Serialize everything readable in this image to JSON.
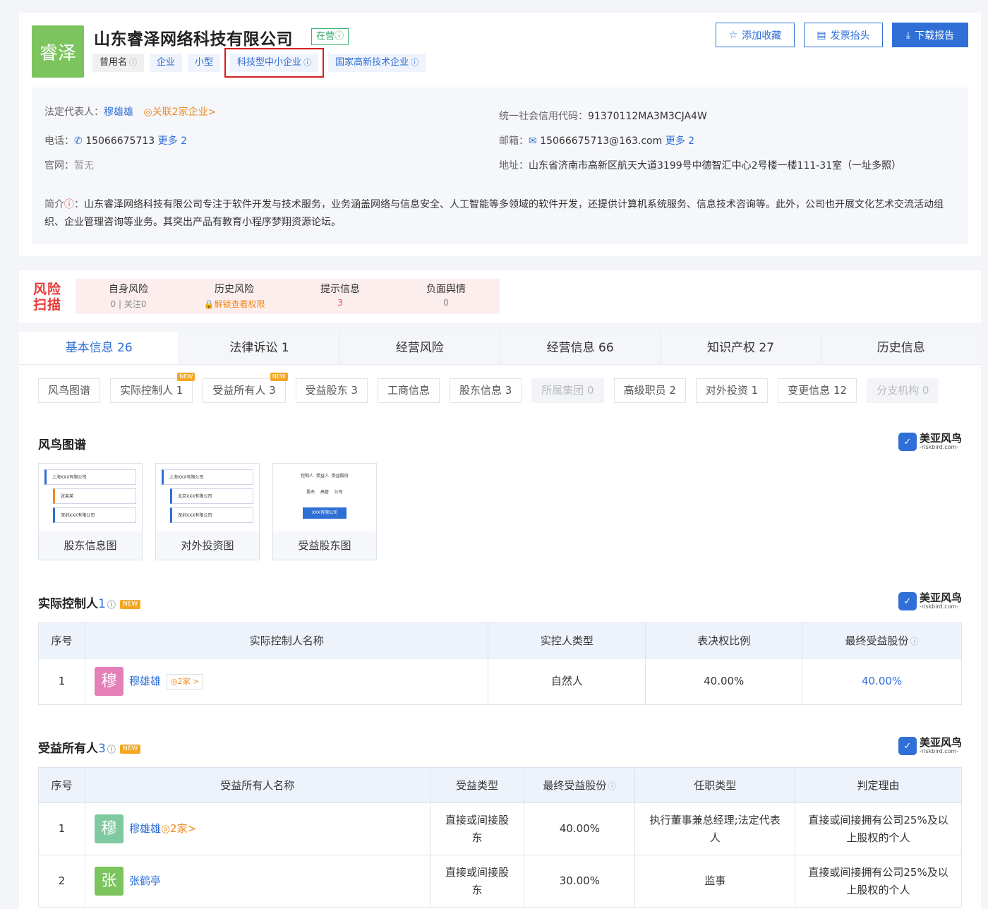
{
  "company": {
    "logo_text": "睿泽",
    "name": "山东睿泽网络科技有限公司",
    "status": "在营ⓘ",
    "tags": [
      {
        "label": "曾用名",
        "info": "ⓘ"
      },
      {
        "label": "企业",
        "info": ""
      },
      {
        "label": "小型",
        "info": ""
      },
      {
        "label": "科技型中小企业",
        "info": "ⓘ"
      },
      {
        "label": "国家高新技术企业",
        "info": "ⓘ"
      }
    ]
  },
  "actions": {
    "favorite": "添加收藏",
    "invoice": "发票抬头",
    "download": "下载报告"
  },
  "info": {
    "legal_rep_label": "法定代表人：",
    "legal_rep": "穆雄雄",
    "related": "关联2家企业>",
    "credit_label": "统一社会信用代码：",
    "credit_code": "91370112MA3M3CJA4W",
    "phone_label": "电话：",
    "phone": "15066675713",
    "phone_more": "更多 2",
    "email_label": "邮箱：",
    "email": "15066675713@163.com",
    "email_more": "更多 2",
    "website_label": "官网：",
    "website": "暂无",
    "address_label": "地址：",
    "address": "山东省济南市高新区航天大道3199号中德智汇中心2号楼一楼111-31室（一址多照）",
    "intro_label": "简介",
    "intro": "山东睿泽网络科技有限公司专注于软件开发与技术服务，业务涵盖网络与信息安全、人工智能等多领域的软件开发，还提供计算机系统服务、信息技术咨询等。此外，公司也开展文化艺术交流活动组织、企业管理咨询等业务。其突出产品有教育小程序梦翔资源论坛。"
  },
  "risk": {
    "logo_line1": "风险",
    "logo_line2": "扫描",
    "items": [
      {
        "title": "自身风险",
        "value": "0 | 关注0"
      },
      {
        "title": "历史风险",
        "value": "解锁查看权限"
      },
      {
        "title": "提示信息",
        "value": "3"
      },
      {
        "title": "负面舆情",
        "value": "0"
      }
    ]
  },
  "tabs": [
    "基本信息 26",
    "法律诉讼 1",
    "经营风险",
    "经营信息 66",
    "知识产权 27",
    "历史信息"
  ],
  "subtabs": [
    {
      "label": "风鸟图谱"
    },
    {
      "label": "实际控制人 1",
      "badge": "NEW"
    },
    {
      "label": "受益所有人 3",
      "badge": "NEW"
    },
    {
      "label": "受益股东 3"
    },
    {
      "label": "工商信息"
    },
    {
      "label": "股东信息 3"
    },
    {
      "label": "所属集团 0"
    },
    {
      "label": "高级职员 2"
    },
    {
      "label": "对外投资 1"
    },
    {
      "label": "变更信息 12"
    },
    {
      "label": "分支机构 0"
    }
  ],
  "brand": {
    "name": "美亚风鸟",
    "sub": "-riskbird.com-"
  },
  "graph": {
    "title": "风鸟图谱",
    "cards": [
      {
        "caption": "股东信息图",
        "line1": "上海XXX有限公司",
        "line2": "张某某",
        "line3": "深圳XXX有限公司"
      },
      {
        "caption": "对外投资图",
        "line1": "上海XXX有限公司",
        "line2": "北京XXX有限公司",
        "line3": "深圳XXX有限公司"
      },
      {
        "caption": "受益股东图",
        "line1": "控制人  受益人  受益股份",
        "line2": "股东    高管    公司",
        "line3": "XXX有限公司"
      }
    ]
  },
  "controller": {
    "title": "实际控制人",
    "count": "1",
    "badge": "NEW",
    "headers": [
      "序号",
      "实际控制人名称",
      "实控人类型",
      "表决权比例",
      "最终受益股份"
    ],
    "rows": [
      {
        "no": "1",
        "avatar": "穆",
        "name": "穆雄雄",
        "chip": "2家 >",
        "type": "自然人",
        "vote": "40.00%",
        "share": "40.00%"
      }
    ]
  },
  "beneficiary": {
    "title": "受益所有人",
    "count": "3",
    "badge": "NEW",
    "headers": [
      "序号",
      "受益所有人名称",
      "受益类型",
      "最终受益股份",
      "任职类型",
      "判定理由"
    ],
    "rows": [
      {
        "no": "1",
        "avatar": "穆",
        "name": "穆雄雄",
        "extra": "2家>",
        "type": "直接或间接股东",
        "share": "40.00%",
        "role": "执行董事兼总经理;法定代表人",
        "reason": "直接或间接拥有公司25%及以上股权的个人"
      },
      {
        "no": "2",
        "avatar": "张",
        "name": "张鹤亭",
        "extra": "",
        "type": "直接或间接股东",
        "share": "30.00%",
        "role": "监事",
        "reason": "直接或间接拥有公司25%及以上股权的个人"
      }
    ]
  },
  "colors": {
    "accent": "#2f6fd6",
    "logo_bg": "#7bc45e",
    "avatar_mu": "#e47fb8",
    "avatar_mu2": "#7fc9a0",
    "avatar_zhang": "#7bc45e"
  }
}
